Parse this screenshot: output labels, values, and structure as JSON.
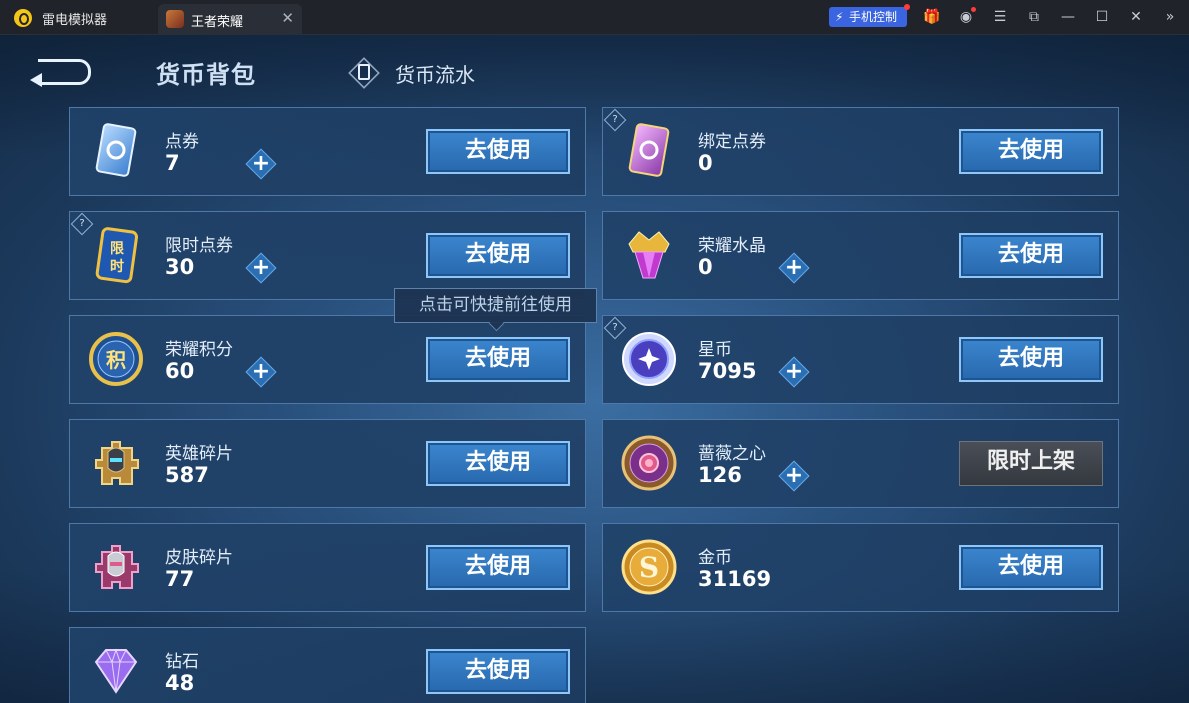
{
  "window": {
    "app_name": "雷电模拟器",
    "tab_title": "王者荣耀",
    "phone_control_label": "手机控制",
    "icons": [
      "gift-icon",
      "user-icon",
      "menu-icon",
      "restore-icon",
      "minimize-icon",
      "maximize-icon",
      "close-icon",
      "expand-icon"
    ]
  },
  "header": {
    "title": "货币背包",
    "flow_tab": "货币流水"
  },
  "tooltip": "点击可快捷前往使用",
  "colors": {
    "accent_blue": "#2868ad",
    "button_border": "#8ec6f5",
    "badge_red": "#ff3b3b",
    "phone_control": "#3a64e0"
  },
  "currencies": [
    {
      "name": "点券",
      "value": "7",
      "button": "去使用",
      "icon": "ticket-card-icon",
      "has_plus": true,
      "has_help": false
    },
    {
      "name": "绑定点券",
      "value": "0",
      "button": "去使用",
      "icon": "bound-ticket-card-icon",
      "has_plus": false,
      "has_help": true
    },
    {
      "name": "限时点券",
      "value": "30",
      "button": "去使用",
      "icon": "limited-ticket-icon",
      "has_plus": true,
      "has_help": true
    },
    {
      "name": "荣耀水晶",
      "value": "0",
      "button": "去使用",
      "icon": "glory-crystal-icon",
      "has_plus": true,
      "has_help": false
    },
    {
      "name": "荣耀积分",
      "value": "60",
      "button": "去使用",
      "icon": "glory-points-icon",
      "has_plus": true,
      "has_help": false
    },
    {
      "name": "星币",
      "value": "7095",
      "button": "去使用",
      "icon": "star-coin-icon",
      "has_plus": true,
      "has_help": true
    },
    {
      "name": "英雄碎片",
      "value": "587",
      "button": "去使用",
      "icon": "hero-fragment-icon",
      "has_plus": false,
      "has_help": false
    },
    {
      "name": "蔷薇之心",
      "value": "126",
      "button": "限时上架",
      "icon": "rose-heart-icon",
      "has_plus": true,
      "has_help": false,
      "button_disabled": true
    },
    {
      "name": "皮肤碎片",
      "value": "77",
      "button": "去使用",
      "icon": "skin-fragment-icon",
      "has_plus": false,
      "has_help": false
    },
    {
      "name": "金币",
      "value": "31169",
      "button": "去使用",
      "icon": "gold-coin-icon",
      "has_plus": false,
      "has_help": false
    },
    {
      "name": "钻石",
      "value": "48",
      "button": "去使用",
      "icon": "diamond-icon",
      "has_plus": false,
      "has_help": false
    }
  ]
}
